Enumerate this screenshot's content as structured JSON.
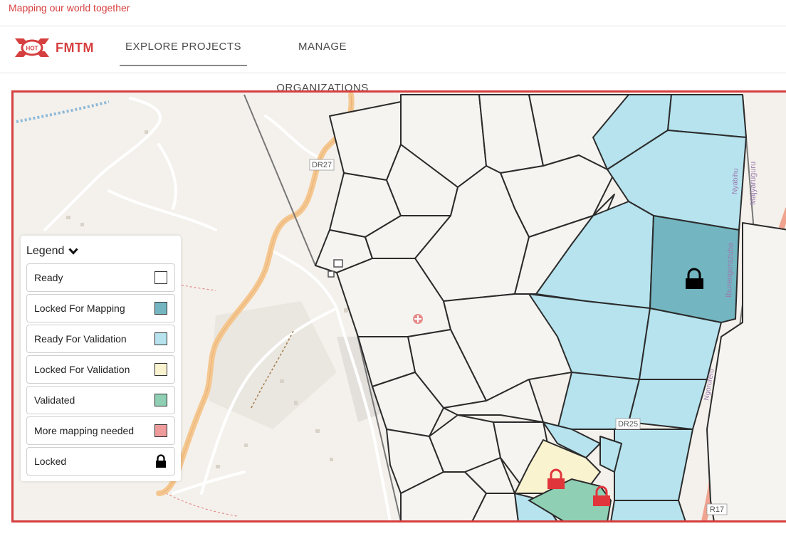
{
  "header": {
    "tagline": "Mapping our world together",
    "logo_badge": "HOT",
    "logo_text": "FMTM",
    "tabs": [
      {
        "label": "EXPLORE PROJECTS",
        "active": true
      },
      {
        "label": "MANAGE ORGANIZATIONS",
        "active": false
      }
    ]
  },
  "map": {
    "road_labels": [
      "DR27",
      "DR25",
      "R17",
      "Majyaruguru",
      "Iburengerazuba",
      "Nyabihu",
      "Ngororero"
    ]
  },
  "legend": {
    "title": "Legend",
    "toggle_icon": "chevron-down-icon",
    "items": [
      {
        "label": "Ready",
        "color": "#ffffff"
      },
      {
        "label": "Locked For Mapping",
        "color": "#73b5c0"
      },
      {
        "label": "Ready For Validation",
        "color": "#b6e3ee"
      },
      {
        "label": "Locked For Validation",
        "color": "#faf3d0"
      },
      {
        "label": "Validated",
        "color": "#8fcfb4"
      },
      {
        "label": "More mapping needed",
        "color": "#ee9b9b"
      },
      {
        "label": "Locked",
        "icon": "lock-icon"
      }
    ]
  },
  "colors": {
    "accent": "#d63f3f",
    "ready_for_validation_fill": "#b6e3ee",
    "locked_for_mapping_fill": "#73b5c0"
  }
}
